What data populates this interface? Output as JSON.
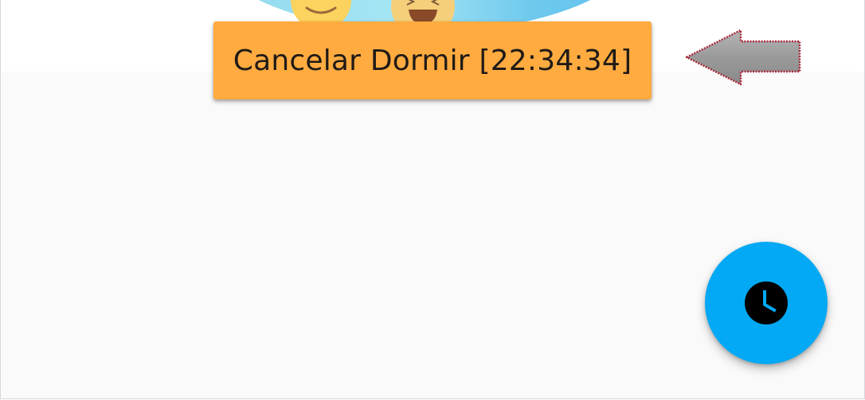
{
  "header": {
    "illustration_icon": "smiling-faces-illustration"
  },
  "sleep_timer": {
    "cancel_label": "Cancelar Dormir [22:34:34]",
    "button_color": "#ffab40",
    "pointer_icon": "left-arrow-icon"
  },
  "fab": {
    "icon": "clock-icon",
    "color": "#03a9f4"
  }
}
